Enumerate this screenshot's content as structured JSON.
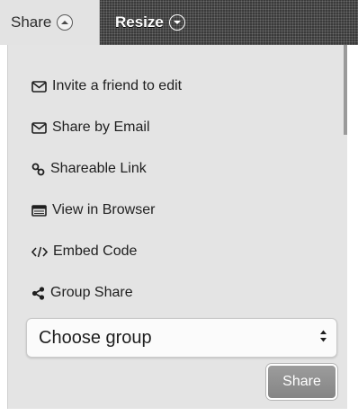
{
  "tabs": {
    "share_label": "Share",
    "share_icon": "chevron-up-circle-icon",
    "resize_label": "Resize",
    "resize_icon": "chevron-down-circle-icon"
  },
  "menu": {
    "items": [
      {
        "label": "Invite a friend to edit",
        "icon": "envelope-icon"
      },
      {
        "label": "Share by Email",
        "icon": "envelope-icon"
      },
      {
        "label": "Shareable Link",
        "icon": "link-icon"
      },
      {
        "label": "View in Browser",
        "icon": "browser-window-icon"
      },
      {
        "label": "Embed Code",
        "icon": "code-icon"
      },
      {
        "label": "Group Share",
        "icon": "share-nodes-icon"
      }
    ]
  },
  "group_select": {
    "value": "Choose group",
    "icon": "updown-arrows-icon"
  },
  "share_button": {
    "label": "Share"
  },
  "colors": {
    "panel": "#e4e4e4",
    "resize_tab": "#3a3a3a",
    "button": "#8f8f8f"
  }
}
